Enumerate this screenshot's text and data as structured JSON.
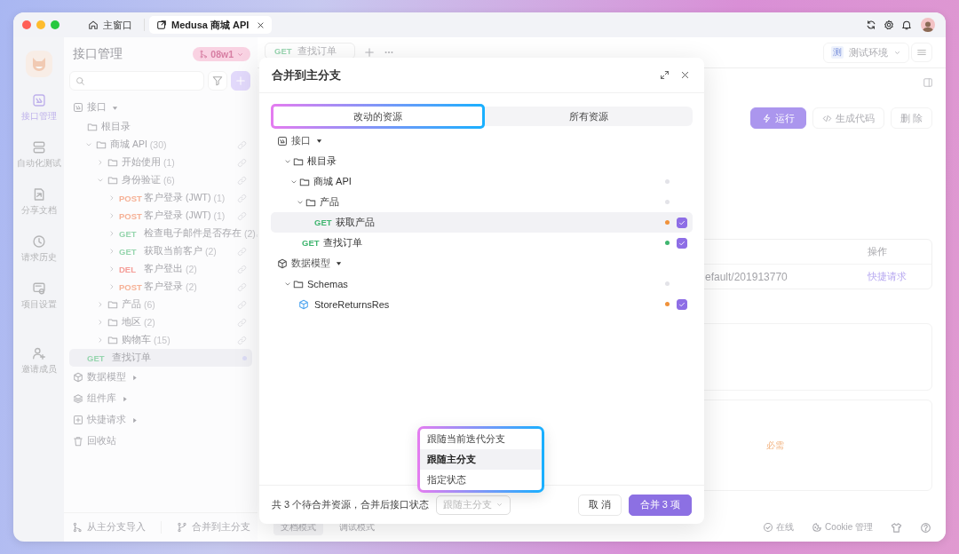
{
  "tabs": [
    {
      "label": "主窗口",
      "kind": "home",
      "selected": false
    },
    {
      "label": "Medusa 商城 API",
      "kind": "project",
      "selected": true,
      "closable": true
    }
  ],
  "rail": {
    "items": [
      {
        "label": "接口管理",
        "kind": "api",
        "selected": true
      },
      {
        "label": "自动化测试",
        "kind": "test",
        "selected": false
      },
      {
        "label": "分享文档",
        "kind": "share",
        "selected": false
      },
      {
        "label": "请求历史",
        "kind": "history",
        "selected": false
      },
      {
        "label": "项目设置",
        "kind": "settings",
        "selected": false
      },
      {
        "label": "邀请成员",
        "kind": "invite",
        "selected": false
      }
    ]
  },
  "sidebar": {
    "title": "接口管理",
    "branch": "08w1",
    "tree": [
      {
        "kind": "endpoints",
        "label": "接口",
        "expanded": true,
        "children": [
          {
            "kind": "folder",
            "label": "根目录"
          },
          {
            "kind": "folder",
            "label": "商城 API",
            "count": "(30)",
            "expanded": true,
            "children": [
              {
                "kind": "folder",
                "label": "开始使用",
                "count": "(1)",
                "expanded": false
              },
              {
                "kind": "folder",
                "label": "身份验证",
                "count": "(6)",
                "expanded": true,
                "children": [
                  {
                    "kind": "api",
                    "method": {
                      "text": "POST",
                      "color": "#f6b196"
                    },
                    "label": "客户登录 (JWT)",
                    "count": "(1)",
                    "expanded": false,
                    "selected": false
                  },
                  {
                    "kind": "api",
                    "method": {
                      "text": "POST",
                      "color": "#f6b196"
                    },
                    "label": "客户登录 (JWT)",
                    "count": "(1)",
                    "expanded": false,
                    "selected": false
                  },
                  {
                    "kind": "api",
                    "method": {
                      "text": "GET",
                      "color": "#96d5ae"
                    },
                    "label": "检查电子邮件是否存在",
                    "count": "(2)",
                    "expanded": false,
                    "selected": false
                  },
                  {
                    "kind": "api",
                    "method": {
                      "text": "GET",
                      "color": "#96d5ae"
                    },
                    "label": "获取当前客户",
                    "count": "(2)",
                    "expanded": false,
                    "selected": false
                  },
                  {
                    "kind": "api",
                    "method": {
                      "text": "DEL",
                      "color": "#f59d98"
                    },
                    "label": "客户登出",
                    "count": "(2)",
                    "expanded": false,
                    "selected": false
                  },
                  {
                    "kind": "api",
                    "method": {
                      "text": "POST",
                      "color": "#f6b196"
                    },
                    "label": "客户登录",
                    "count": "(2)",
                    "expanded": false,
                    "selected": false
                  }
                ]
              },
              {
                "kind": "folder",
                "label": "产品",
                "count": "(6)",
                "expanded": false
              },
              {
                "kind": "folder",
                "label": "地区",
                "count": "(2)",
                "expanded": false
              },
              {
                "kind": "folder",
                "label": "购物车",
                "count": "(15)",
                "expanded": false
              }
            ]
          },
          {
            "kind": "api",
            "method": {
              "text": "GET",
              "color": "#96d5ae"
            },
            "label": "查找订单",
            "selected": true
          }
        ]
      },
      {
        "kind": "models",
        "label": "数据模型",
        "expanded": false
      },
      {
        "kind": "components",
        "label": "组件库",
        "expanded": false
      },
      {
        "kind": "shortcuts",
        "label": "快捷请求",
        "expanded": false
      },
      {
        "kind": "recycle",
        "label": "回收站"
      }
    ],
    "footer": [
      {
        "label": "从主分支导入",
        "kind": "import"
      },
      {
        "label": "合并到主分支",
        "kind": "merge"
      }
    ]
  },
  "main": {
    "request_tab": {
      "method": {
        "text": "GET",
        "color": "#9ad6b1"
      },
      "label": "查找订单"
    },
    "environment": {
      "badge": "测",
      "label": "测试环境"
    },
    "buttons": [
      {
        "label": "运行",
        "kind": "primary"
      },
      {
        "label": "生成代码",
        "kind": "code"
      },
      {
        "label": "删 除",
        "kind": "plain"
      }
    ],
    "table": {
      "action_header": "操作",
      "value": "efault/201913770",
      "action_link": "快捷请求"
    },
    "required_label": "必需",
    "mode_tabs": [
      "文档模式",
      "调试模式"
    ]
  },
  "status_bar": {
    "items": [
      {
        "kind": "online",
        "label": "在线"
      },
      {
        "kind": "cookie",
        "label": "Cookie 管理"
      },
      {
        "kind": "theme"
      },
      {
        "kind": "help"
      }
    ]
  },
  "dialog": {
    "title": "合并到主分支",
    "tabs": [
      {
        "label": "改动的资源",
        "selected": true
      },
      {
        "label": "所有资源",
        "selected": false
      }
    ],
    "tree": [
      {
        "kind": "endpoints",
        "label": "接口",
        "expanded": true,
        "children": [
          {
            "kind": "folder",
            "label": "根目录",
            "expanded": true,
            "children": [
              {
                "kind": "folder",
                "label": "商城 API",
                "expanded": true,
                "color": "#e3e3e8",
                "children": [
                  {
                    "kind": "folder",
                    "label": "产品",
                    "expanded": true,
                    "color": "#e3e3e8",
                    "children": [
                      {
                        "kind": "api",
                        "method": {
                          "text": "GET",
                          "color": "#3fb56f"
                        },
                        "label": "获取产品",
                        "selected": true,
                        "color": "#f0923a",
                        "checked": true
                      }
                    ]
                  }
                ]
              },
              {
                "kind": "api",
                "method": {
                  "text": "GET",
                  "color": "#3fb56f"
                },
                "label": "查找订单",
                "selected": false,
                "color": "#3fb56f",
                "checked": true
              }
            ]
          }
        ]
      },
      {
        "kind": "models",
        "label": "数据模型",
        "expanded": true,
        "children": [
          {
            "kind": "folder",
            "label": "Schemas",
            "expanded": true,
            "color": "#e3e3e8",
            "children": [
              {
                "kind": "schema",
                "label": "StoreReturnsRes",
                "selected": false,
                "color": "#f0923a",
                "checked": true
              }
            ]
          }
        ]
      }
    ],
    "summary": "共 3 个待合并资源，合并后接口状态",
    "status_select": {
      "value": "跟随主分支",
      "open": true
    },
    "status_options": [
      {
        "label": "跟随当前迭代分支",
        "selected": false
      },
      {
        "label": "跟随主分支",
        "selected": true
      },
      {
        "label": "指定状态",
        "selected": false
      }
    ],
    "buttons": [
      {
        "label": "取 消",
        "kind": "secondary"
      },
      {
        "label": "合并 3 项",
        "kind": "primary"
      }
    ]
  }
}
